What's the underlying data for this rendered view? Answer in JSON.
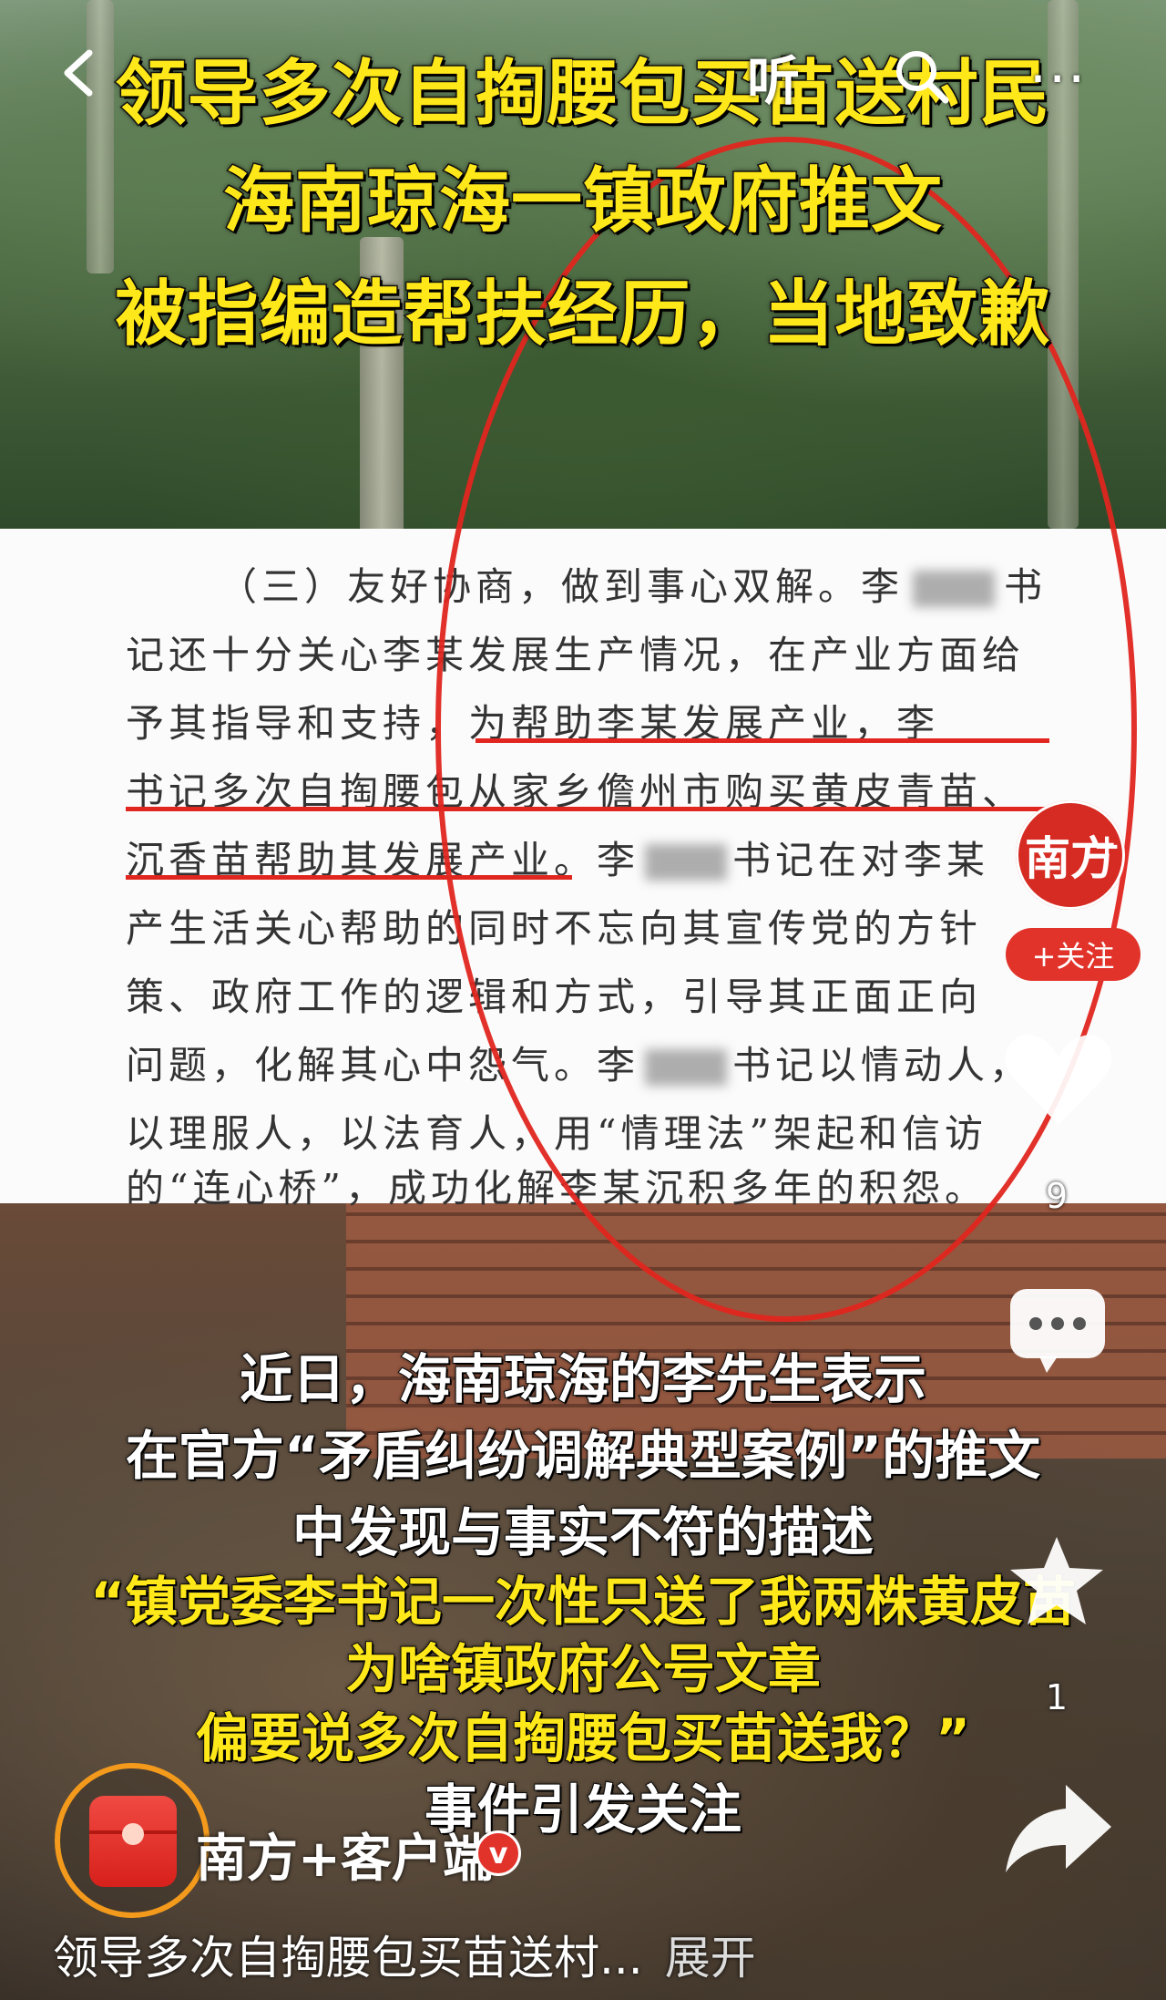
{
  "top_bar": {
    "listen_label": "听",
    "more_label": "···"
  },
  "headline": [
    "领导多次自掏腰包买苗送村民",
    "海南琼海一镇政府推文",
    "被指编造帮扶经历，当地致歉"
  ],
  "document": {
    "lines": [
      "（三）友好协商，做到事心双解。李",
      "记还十分关心李某发展生产情况，在产业方面给",
      "予其指导和支持，为帮助李某发展产业，李",
      "书记多次自掏腰包从家乡儋州市购买黄皮青苗、",
      "沉香苗帮助其发展产业。李",
      "产生活关心帮助的同时不忘向其宣传党的方针",
      "策、政府工作的逻辑和方式，引导其正面正向",
      "问题，化解其心中怨气。李",
      "以理服人，以法育人，用“情理法”架起和信访",
      "的“连心桥”，成功化解李某沉积多年的积怨。"
    ],
    "line1_tail": "书",
    "line5_tail": "书记在对李某",
    "line8_tail": "书记以情动人，"
  },
  "captions": [
    {
      "text": "近日，海南琼海的李先生表示",
      "color": "white"
    },
    {
      "text": "在官方“矛盾纠纷调解典型案例”的推文",
      "color": "white"
    },
    {
      "text": "中发现与事实不符的描述",
      "color": "white"
    },
    {
      "text": "“镇党委李书记一次性只送了我两株黄皮苗",
      "color": "yellow"
    },
    {
      "text": "为啥镇政府公号文章",
      "color": "yellow"
    },
    {
      "text": "偏要说多次自掏腰包买苗送我？”",
      "color": "yellow"
    },
    {
      "text": "事件引发关注",
      "color": "white"
    }
  ],
  "sidebar": {
    "avatar_text": "南方",
    "follow_label": "+关注",
    "like_count": "9",
    "favorite_count": "1"
  },
  "author": {
    "name": "南方+客户端",
    "verified_label": "v"
  },
  "description": {
    "text": "领导多次自掏腰包买苗送村...",
    "expand_label": "展开"
  },
  "colors": {
    "headline_yellow": "#ffe81a",
    "accent_red": "#e2332b",
    "ring_orange": "#f39a1c"
  }
}
